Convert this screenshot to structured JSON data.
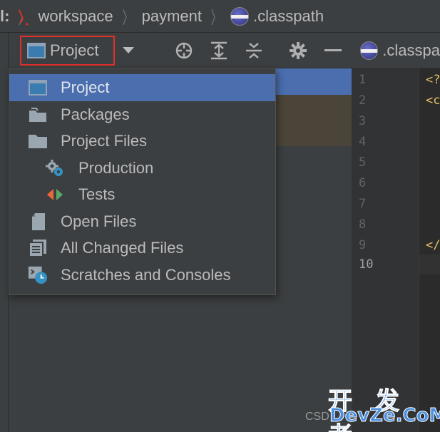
{
  "breadcrumb": {
    "prefix": "l:",
    "items": [
      "workspace",
      "payment",
      ".classpath"
    ]
  },
  "toolwindow": {
    "view_selector_label": "Project"
  },
  "editor": {
    "tab_label": ".classpa",
    "line_numbers": [
      "1",
      "2",
      "3",
      "4",
      "5",
      "6",
      "7",
      "8",
      "9",
      "10"
    ],
    "code_fragments": {
      "line1": "<?",
      "line2": "<c",
      "line9": "</"
    }
  },
  "popup": {
    "items": [
      {
        "label": "Project",
        "icon": "project-window-icon",
        "selected": true
      },
      {
        "label": "Packages",
        "icon": "packages-folder-icon"
      },
      {
        "label": "Project Files",
        "icon": "folder-icon"
      },
      {
        "label": "Production",
        "icon": "production-gear-icon"
      },
      {
        "label": "Tests",
        "icon": "tests-arrows-icon"
      },
      {
        "label": "Open Files",
        "icon": "open-files-icon"
      },
      {
        "label": "All Changed Files",
        "icon": "changed-files-icon"
      },
      {
        "label": "Scratches and Consoles",
        "icon": "scratches-consoles-icon"
      }
    ]
  },
  "watermark": {
    "line1": "开 发 者",
    "line2": "DevZe.CoM",
    "prefix": "CSD"
  },
  "colors": {
    "selection": "#4b6eaf",
    "highlight_border": "#e0302a",
    "panel": "#3c3f41"
  }
}
